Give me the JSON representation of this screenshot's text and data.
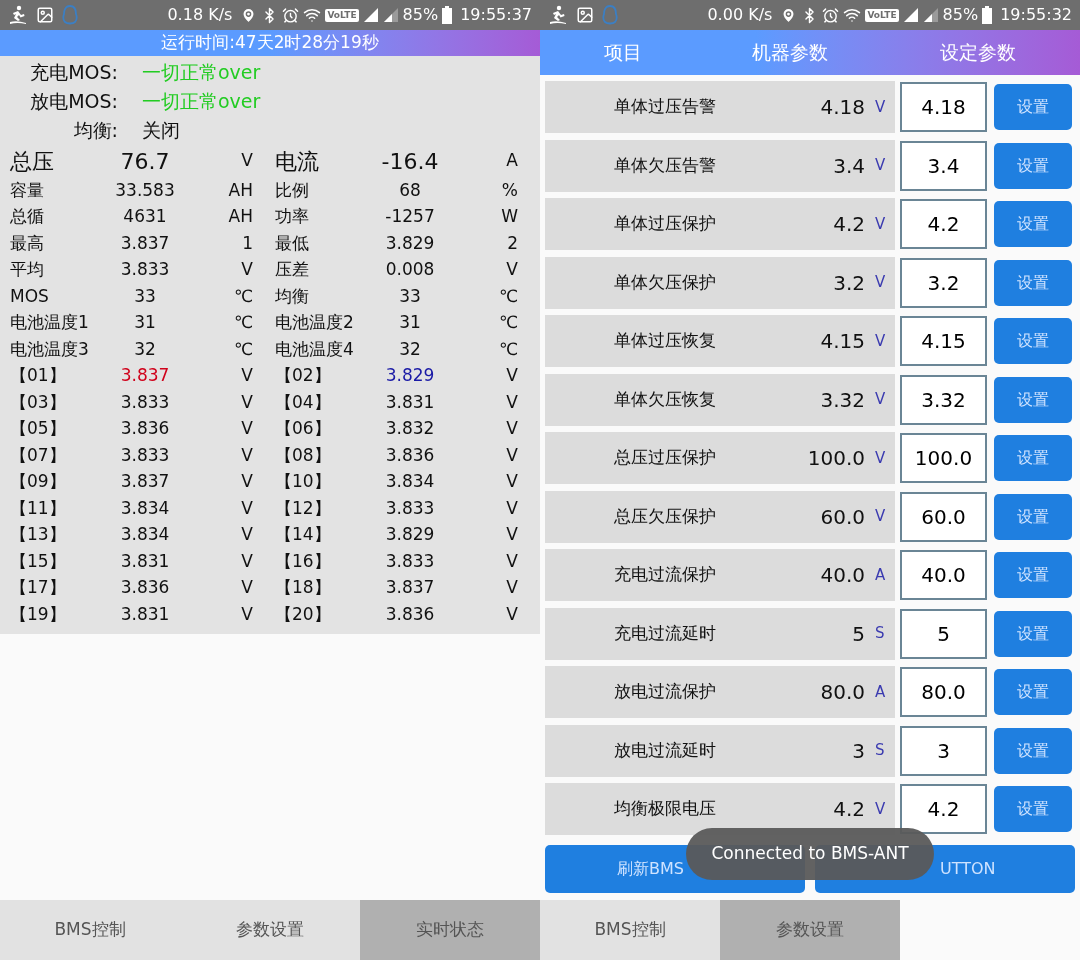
{
  "status_screen": {
    "status_bar": {
      "speed": "0.18 K/s",
      "volte": "VoLTE",
      "battery": "85%",
      "time": "19:55:37"
    },
    "runtime": "运行时间:47天2时28分19秒",
    "status_lines": [
      {
        "label": "充电MOS:",
        "value": "一切正常over",
        "kind": "ok"
      },
      {
        "label": "放电MOS:",
        "value": "一切正常over",
        "kind": "ok"
      },
      {
        "label": "均衡:",
        "value": "关闭",
        "kind": "plain"
      }
    ],
    "metrics": [
      {
        "kind": "large",
        "items": [
          {
            "label": "总压",
            "value": "76.7",
            "unit": "V"
          },
          {
            "label": "电流",
            "value": "-16.4",
            "unit": "A"
          }
        ]
      },
      {
        "kind": "normal",
        "items": [
          {
            "label": "容量",
            "value": "33.583",
            "unit": "AH"
          },
          {
            "label": "比例",
            "value": "68",
            "unit": "%"
          }
        ]
      },
      {
        "kind": "normal",
        "items": [
          {
            "label": "总循",
            "value": "4631",
            "unit": "AH"
          },
          {
            "label": "功率",
            "value": "-1257",
            "unit": "W"
          }
        ]
      },
      {
        "kind": "normal",
        "items": [
          {
            "label": "最高",
            "value": "3.837",
            "unit": "1"
          },
          {
            "label": "最低",
            "value": "3.829",
            "unit": "2"
          }
        ]
      },
      {
        "kind": "normal",
        "items": [
          {
            "label": "平均",
            "value": "3.833",
            "unit": "V"
          },
          {
            "label": "压差",
            "value": "0.008",
            "unit": "V"
          }
        ]
      },
      {
        "kind": "normal",
        "items": [
          {
            "label": "MOS",
            "value": "33",
            "unit": "℃"
          },
          {
            "label": "均衡",
            "value": "33",
            "unit": "℃"
          }
        ]
      },
      {
        "kind": "normal",
        "items": [
          {
            "label": "电池温度1",
            "value": "31",
            "unit": "℃"
          },
          {
            "label": "电池温度2",
            "value": "31",
            "unit": "℃"
          }
        ]
      },
      {
        "kind": "normal",
        "items": [
          {
            "label": "电池温度3",
            "value": "32",
            "unit": "℃"
          },
          {
            "label": "电池温度4",
            "value": "32",
            "unit": "℃"
          }
        ]
      }
    ],
    "cells": [
      {
        "label": "【01】",
        "value": "3.837",
        "unit": "V",
        "color": "#d0021b"
      },
      {
        "label": "【02】",
        "value": "3.829",
        "unit": "V",
        "color": "#1a1aa6"
      },
      {
        "label": "【03】",
        "value": "3.833",
        "unit": "V",
        "color": "#111111"
      },
      {
        "label": "【04】",
        "value": "3.831",
        "unit": "V",
        "color": "#111111"
      },
      {
        "label": "【05】",
        "value": "3.836",
        "unit": "V",
        "color": "#111111"
      },
      {
        "label": "【06】",
        "value": "3.832",
        "unit": "V",
        "color": "#111111"
      },
      {
        "label": "【07】",
        "value": "3.833",
        "unit": "V",
        "color": "#111111"
      },
      {
        "label": "【08】",
        "value": "3.836",
        "unit": "V",
        "color": "#111111"
      },
      {
        "label": "【09】",
        "value": "3.837",
        "unit": "V",
        "color": "#111111"
      },
      {
        "label": "【10】",
        "value": "3.834",
        "unit": "V",
        "color": "#111111"
      },
      {
        "label": "【11】",
        "value": "3.834",
        "unit": "V",
        "color": "#111111"
      },
      {
        "label": "【12】",
        "value": "3.833",
        "unit": "V",
        "color": "#111111"
      },
      {
        "label": "【13】",
        "value": "3.834",
        "unit": "V",
        "color": "#111111"
      },
      {
        "label": "【14】",
        "value": "3.829",
        "unit": "V",
        "color": "#111111"
      },
      {
        "label": "【15】",
        "value": "3.831",
        "unit": "V",
        "color": "#111111"
      },
      {
        "label": "【16】",
        "value": "3.833",
        "unit": "V",
        "color": "#111111"
      },
      {
        "label": "【17】",
        "value": "3.836",
        "unit": "V",
        "color": "#111111"
      },
      {
        "label": "【18】",
        "value": "3.837",
        "unit": "V",
        "color": "#111111"
      },
      {
        "label": "【19】",
        "value": "3.831",
        "unit": "V",
        "color": "#111111"
      },
      {
        "label": "【20】",
        "value": "3.836",
        "unit": "V",
        "color": "#111111"
      }
    ],
    "tabs": [
      {
        "label": "BMS控制",
        "selected": false
      },
      {
        "label": "参数设置",
        "selected": false
      },
      {
        "label": "实时状态",
        "selected": true
      }
    ]
  },
  "settings_screen": {
    "status_bar": {
      "speed": "0.00 K/s",
      "volte": "VoLTE",
      "battery": "85%",
      "time": "19:55:32"
    },
    "columns": [
      "项目",
      "机器参数",
      "设定参数"
    ],
    "params": [
      {
        "name": "单体过压告警",
        "reading": "4.18",
        "unit": "V",
        "value": "4.18",
        "button": "设置"
      },
      {
        "name": "单体欠压告警",
        "reading": "3.4",
        "unit": "V",
        "value": "3.4",
        "button": "设置"
      },
      {
        "name": "单体过压保护",
        "reading": "4.2",
        "unit": "V",
        "value": "4.2",
        "button": "设置"
      },
      {
        "name": "单体欠压保护",
        "reading": "3.2",
        "unit": "V",
        "value": "3.2",
        "button": "设置"
      },
      {
        "name": "单体过压恢复",
        "reading": "4.15",
        "unit": "V",
        "value": "4.15",
        "button": "设置"
      },
      {
        "name": "单体欠压恢复",
        "reading": "3.32",
        "unit": "V",
        "value": "3.32",
        "button": "设置"
      },
      {
        "name": "总压过压保护",
        "reading": "100.0",
        "unit": "V",
        "value": "100.0",
        "button": "设置"
      },
      {
        "name": "总压欠压保护",
        "reading": "60.0",
        "unit": "V",
        "value": "60.0",
        "button": "设置"
      },
      {
        "name": "充电过流保护",
        "reading": "40.0",
        "unit": "A",
        "value": "40.0",
        "button": "设置"
      },
      {
        "name": "充电过流延时",
        "reading": "5",
        "unit": "S",
        "value": "5",
        "button": "设置"
      },
      {
        "name": "放电过流保护",
        "reading": "80.0",
        "unit": "A",
        "value": "80.0",
        "button": "设置"
      },
      {
        "name": "放电过流延时",
        "reading": "3",
        "unit": "S",
        "value": "3",
        "button": "设置"
      },
      {
        "name": "均衡极限电压",
        "reading": "4.2",
        "unit": "V",
        "value": "4.2",
        "button": "设置"
      }
    ],
    "actions": [
      "刷新BMS",
      "UTTON"
    ],
    "toast": "Connected to BMS-ANT",
    "tabs": [
      {
        "label": "BMS控制",
        "selected": false
      },
      {
        "label": "参数设置",
        "selected": true
      }
    ]
  }
}
